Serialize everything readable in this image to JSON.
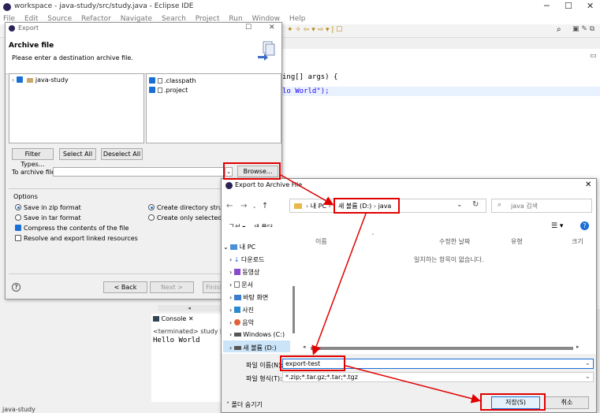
{
  "eclipse": {
    "title": "workspace - java-study/src/study.java - Eclipse IDE",
    "menu": [
      "File",
      "Edit",
      "Source",
      "Refactor",
      "Navigate",
      "Search",
      "Project",
      "Run",
      "Window",
      "Help"
    ],
    "code_line1": "ing[] args) {",
    "code_line2": "lo World\");",
    "console_tab": "Console",
    "console_status": "<terminated> study [Jav",
    "console_output": "Hello World",
    "status_bar": "java-study"
  },
  "export": {
    "window_title": "Export",
    "heading": "Archive file",
    "subtitle": "Please enter a destination archive file.",
    "tree_item": "java-study",
    "files": [
      ".classpath",
      ".project"
    ],
    "filter_types": "Filter Types...",
    "select_all": "Select All",
    "deselect_all": "Deselect All",
    "to_archive_label": "To archive file:",
    "browse": "Browse...",
    "options_label": "Options",
    "save_zip": "Save in zip format",
    "save_tar": "Save in tar format",
    "compress": "Compress the contents of the file",
    "resolve": "Resolve and export linked resources",
    "create_dir": "Create directory structu",
    "create_selected": "Create only selected dir",
    "back": "< Back",
    "next": "Next >",
    "finish": "Finish",
    "help": "?"
  },
  "file_dialog": {
    "title": "Export to Archive File",
    "path": [
      "내 PC",
      "새 볼륨 (D:)",
      "java"
    ],
    "search_placeholder": "java 검색",
    "organize": "구성",
    "new_folder": "새 폴더",
    "columns": [
      "이름",
      "수정한 날짜",
      "유형",
      "크기"
    ],
    "empty_message": "일치하는 항목이 없습니다.",
    "nav": [
      "내 PC",
      "다운로드",
      "동영상",
      "문서",
      "바탕 화면",
      "사진",
      "음악",
      "Windows (C:)",
      "새 볼륨 (D:)"
    ],
    "filename_label": "파일 이름(N):",
    "filename_value": "export-test",
    "filetype_label": "파일 형식(T):",
    "filetype_value": "*.zip;*.tar.gz;*.tar;*.tgz",
    "hide_folders": "폴더 숨기기",
    "save": "저장(S)",
    "cancel": "취소"
  },
  "colors": {
    "highlight": "#e00000",
    "accent": "#1a6fd6"
  }
}
